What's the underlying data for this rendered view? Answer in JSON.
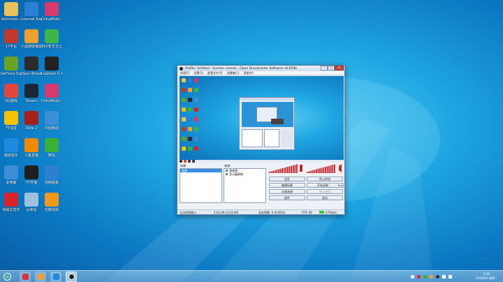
{
  "desktop": {
    "icons": [
      {
        "label": "Administr...",
        "icon": "user-folder-icon",
        "color": "#e8c25a"
      },
      {
        "label": "Internet Explorer",
        "icon": "internet-explorer-icon",
        "color": "#2b7fd4"
      },
      {
        "label": "ChinaMobi...",
        "icon": "china-mobile-icon",
        "color": "#d43a6b"
      },
      {
        "label": "17平台",
        "icon": "platform-icon",
        "color": "#c0392b"
      },
      {
        "label": "小黑媒体播放",
        "icon": "media-player-icon",
        "color": "#f0a030"
      },
      {
        "label": "360安全卫士",
        "icon": "360-security-icon",
        "color": "#3fb44a"
      },
      {
        "label": "GeForce Experience",
        "icon": "geforce-icon",
        "color": "#6aa324"
      },
      {
        "label": "Open Broadcaster",
        "icon": "obs-icon",
        "color": "#2b2b2b"
      },
      {
        "label": "Logitech G HUB",
        "icon": "logitech-icon",
        "color": "#222222"
      },
      {
        "label": "QQ游戏",
        "icon": "qq-game-icon",
        "color": "#e2453c"
      },
      {
        "label": "Steam",
        "icon": "steam-icon",
        "color": "#1b2838"
      },
      {
        "label": "ChinaMobi...",
        "icon": "china-mobile-icon",
        "color": "#d43a6b"
      },
      {
        "label": "YY语音",
        "icon": "yy-icon",
        "color": "#f6c200"
      },
      {
        "label": "Dota 2",
        "icon": "dota-icon",
        "color": "#a3201c"
      },
      {
        "label": "中国移动",
        "icon": "mobile-app-icon",
        "color": "#3a8fd6"
      },
      {
        "label": "酷狗音乐",
        "icon": "kugou-icon",
        "color": "#1f8be0"
      },
      {
        "label": "斗鱼直播",
        "icon": "douyu-icon",
        "color": "#f08a00"
      },
      {
        "label": "微信",
        "icon": "wechat-icon",
        "color": "#3cb034"
      },
      {
        "label": "此电脑",
        "icon": "computer-icon",
        "color": "#3c8ed8"
      },
      {
        "label": "YY开播",
        "icon": "yy-live-icon",
        "color": "#1e1e1e"
      },
      {
        "label": "控制面板",
        "icon": "control-panel-icon",
        "color": "#2f7fd0"
      },
      {
        "label": "网易云音乐",
        "icon": "netease-music-icon",
        "color": "#d6252a"
      },
      {
        "label": "回收站",
        "icon": "recycle-bin-icon",
        "color": "#9cc2e0"
      },
      {
        "label": "优酷视频",
        "icon": "youku-icon",
        "color": "#f39a1e"
      }
    ]
  },
  "obs": {
    "title": "Profile: Untitled - Scenes: scenes - Open Broadcaster Software v0.659b",
    "menu": [
      "档案(F)",
      "设置(S)",
      "配置文件(P)",
      "场景集(C)",
      "帮助(H)"
    ],
    "scenes_label": "场景:",
    "sources_label": "来源:",
    "scene_item": "场景",
    "source_items": [
      "游戏源",
      "显示器获取"
    ],
    "buttons": {
      "settings": "设定",
      "stop_stream": "停止串流",
      "edit_scene": "编辑场景",
      "start_record": "开始录制",
      "global_sources": "全域来源",
      "stop_preview": "停止预览",
      "plugins": "插件",
      "exit": "退出"
    },
    "status": {
      "left": "无法找到窗口",
      "time": "2:03:49 (2:03:49)",
      "dropped": "丢失帧数: 0 (0.00%)",
      "fps": "FPS: 60",
      "bitrate": "576kb/s"
    }
  },
  "taskbar": {
    "clock_time": "4:06",
    "clock_date": "2020/8/3 星期一"
  }
}
